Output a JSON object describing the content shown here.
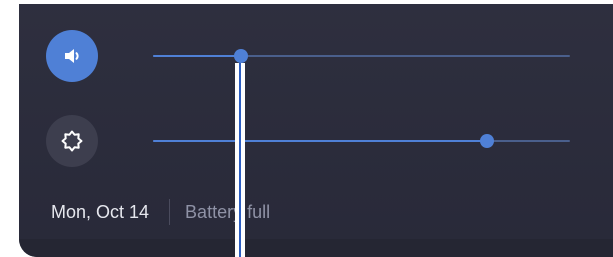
{
  "volume": {
    "icon": "volume-icon",
    "level_percent": 21
  },
  "brightness": {
    "icon": "brightness-icon",
    "level_percent": 80
  },
  "status": {
    "date": "Mon, Oct 14",
    "battery": "Battery full"
  },
  "colors": {
    "panel_background": "#2a2b3b",
    "accent": "#4f80d6",
    "primary_text": "#e6e7ee",
    "secondary_text": "#8f92a6"
  }
}
